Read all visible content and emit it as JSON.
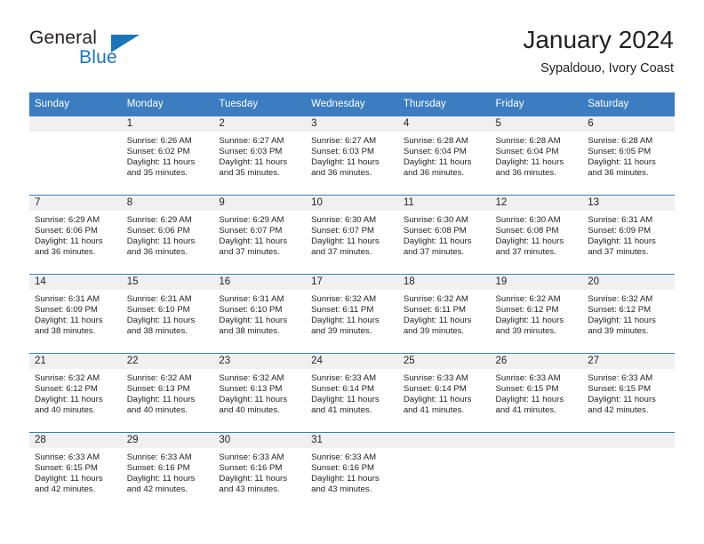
{
  "brand": {
    "name_part1": "General",
    "name_part2": "Blue",
    "logo_icon": "triangle-logo-icon"
  },
  "header": {
    "title": "January 2024",
    "subtitle": "Sypaldouo, Ivory Coast"
  },
  "colors": {
    "header_blue": "#3b7dc0",
    "brand_blue": "#1b75bb",
    "daynum_bg": "#f0f0f0",
    "text": "#231f20"
  },
  "calendar": {
    "weekdays": [
      "Sunday",
      "Monday",
      "Tuesday",
      "Wednesday",
      "Thursday",
      "Friday",
      "Saturday"
    ],
    "weeks": [
      [
        {
          "day": "",
          "blank": true,
          "sunrise": "",
          "sunset": "",
          "daylight1": "",
          "daylight2": ""
        },
        {
          "day": "1",
          "blank": false,
          "sunrise": "Sunrise: 6:26 AM",
          "sunset": "Sunset: 6:02 PM",
          "daylight1": "Daylight: 11 hours",
          "daylight2": "and 35 minutes."
        },
        {
          "day": "2",
          "blank": false,
          "sunrise": "Sunrise: 6:27 AM",
          "sunset": "Sunset: 6:03 PM",
          "daylight1": "Daylight: 11 hours",
          "daylight2": "and 35 minutes."
        },
        {
          "day": "3",
          "blank": false,
          "sunrise": "Sunrise: 6:27 AM",
          "sunset": "Sunset: 6:03 PM",
          "daylight1": "Daylight: 11 hours",
          "daylight2": "and 36 minutes."
        },
        {
          "day": "4",
          "blank": false,
          "sunrise": "Sunrise: 6:28 AM",
          "sunset": "Sunset: 6:04 PM",
          "daylight1": "Daylight: 11 hours",
          "daylight2": "and 36 minutes."
        },
        {
          "day": "5",
          "blank": false,
          "sunrise": "Sunrise: 6:28 AM",
          "sunset": "Sunset: 6:04 PM",
          "daylight1": "Daylight: 11 hours",
          "daylight2": "and 36 minutes."
        },
        {
          "day": "6",
          "blank": false,
          "sunrise": "Sunrise: 6:28 AM",
          "sunset": "Sunset: 6:05 PM",
          "daylight1": "Daylight: 11 hours",
          "daylight2": "and 36 minutes."
        }
      ],
      [
        {
          "day": "7",
          "blank": false,
          "sunrise": "Sunrise: 6:29 AM",
          "sunset": "Sunset: 6:06 PM",
          "daylight1": "Daylight: 11 hours",
          "daylight2": "and 36 minutes."
        },
        {
          "day": "8",
          "blank": false,
          "sunrise": "Sunrise: 6:29 AM",
          "sunset": "Sunset: 6:06 PM",
          "daylight1": "Daylight: 11 hours",
          "daylight2": "and 36 minutes."
        },
        {
          "day": "9",
          "blank": false,
          "sunrise": "Sunrise: 6:29 AM",
          "sunset": "Sunset: 6:07 PM",
          "daylight1": "Daylight: 11 hours",
          "daylight2": "and 37 minutes."
        },
        {
          "day": "10",
          "blank": false,
          "sunrise": "Sunrise: 6:30 AM",
          "sunset": "Sunset: 6:07 PM",
          "daylight1": "Daylight: 11 hours",
          "daylight2": "and 37 minutes."
        },
        {
          "day": "11",
          "blank": false,
          "sunrise": "Sunrise: 6:30 AM",
          "sunset": "Sunset: 6:08 PM",
          "daylight1": "Daylight: 11 hours",
          "daylight2": "and 37 minutes."
        },
        {
          "day": "12",
          "blank": false,
          "sunrise": "Sunrise: 6:30 AM",
          "sunset": "Sunset: 6:08 PM",
          "daylight1": "Daylight: 11 hours",
          "daylight2": "and 37 minutes."
        },
        {
          "day": "13",
          "blank": false,
          "sunrise": "Sunrise: 6:31 AM",
          "sunset": "Sunset: 6:09 PM",
          "daylight1": "Daylight: 11 hours",
          "daylight2": "and 37 minutes."
        }
      ],
      [
        {
          "day": "14",
          "blank": false,
          "sunrise": "Sunrise: 6:31 AM",
          "sunset": "Sunset: 6:09 PM",
          "daylight1": "Daylight: 11 hours",
          "daylight2": "and 38 minutes."
        },
        {
          "day": "15",
          "blank": false,
          "sunrise": "Sunrise: 6:31 AM",
          "sunset": "Sunset: 6:10 PM",
          "daylight1": "Daylight: 11 hours",
          "daylight2": "and 38 minutes."
        },
        {
          "day": "16",
          "blank": false,
          "sunrise": "Sunrise: 6:31 AM",
          "sunset": "Sunset: 6:10 PM",
          "daylight1": "Daylight: 11 hours",
          "daylight2": "and 38 minutes."
        },
        {
          "day": "17",
          "blank": false,
          "sunrise": "Sunrise: 6:32 AM",
          "sunset": "Sunset: 6:11 PM",
          "daylight1": "Daylight: 11 hours",
          "daylight2": "and 39 minutes."
        },
        {
          "day": "18",
          "blank": false,
          "sunrise": "Sunrise: 6:32 AM",
          "sunset": "Sunset: 6:11 PM",
          "daylight1": "Daylight: 11 hours",
          "daylight2": "and 39 minutes."
        },
        {
          "day": "19",
          "blank": false,
          "sunrise": "Sunrise: 6:32 AM",
          "sunset": "Sunset: 6:12 PM",
          "daylight1": "Daylight: 11 hours",
          "daylight2": "and 39 minutes."
        },
        {
          "day": "20",
          "blank": false,
          "sunrise": "Sunrise: 6:32 AM",
          "sunset": "Sunset: 6:12 PM",
          "daylight1": "Daylight: 11 hours",
          "daylight2": "and 39 minutes."
        }
      ],
      [
        {
          "day": "21",
          "blank": false,
          "sunrise": "Sunrise: 6:32 AM",
          "sunset": "Sunset: 6:12 PM",
          "daylight1": "Daylight: 11 hours",
          "daylight2": "and 40 minutes."
        },
        {
          "day": "22",
          "blank": false,
          "sunrise": "Sunrise: 6:32 AM",
          "sunset": "Sunset: 6:13 PM",
          "daylight1": "Daylight: 11 hours",
          "daylight2": "and 40 minutes."
        },
        {
          "day": "23",
          "blank": false,
          "sunrise": "Sunrise: 6:32 AM",
          "sunset": "Sunset: 6:13 PM",
          "daylight1": "Daylight: 11 hours",
          "daylight2": "and 40 minutes."
        },
        {
          "day": "24",
          "blank": false,
          "sunrise": "Sunrise: 6:33 AM",
          "sunset": "Sunset: 6:14 PM",
          "daylight1": "Daylight: 11 hours",
          "daylight2": "and 41 minutes."
        },
        {
          "day": "25",
          "blank": false,
          "sunrise": "Sunrise: 6:33 AM",
          "sunset": "Sunset: 6:14 PM",
          "daylight1": "Daylight: 11 hours",
          "daylight2": "and 41 minutes."
        },
        {
          "day": "26",
          "blank": false,
          "sunrise": "Sunrise: 6:33 AM",
          "sunset": "Sunset: 6:15 PM",
          "daylight1": "Daylight: 11 hours",
          "daylight2": "and 41 minutes."
        },
        {
          "day": "27",
          "blank": false,
          "sunrise": "Sunrise: 6:33 AM",
          "sunset": "Sunset: 6:15 PM",
          "daylight1": "Daylight: 11 hours",
          "daylight2": "and 42 minutes."
        }
      ],
      [
        {
          "day": "28",
          "blank": false,
          "sunrise": "Sunrise: 6:33 AM",
          "sunset": "Sunset: 6:15 PM",
          "daylight1": "Daylight: 11 hours",
          "daylight2": "and 42 minutes."
        },
        {
          "day": "29",
          "blank": false,
          "sunrise": "Sunrise: 6:33 AM",
          "sunset": "Sunset: 6:16 PM",
          "daylight1": "Daylight: 11 hours",
          "daylight2": "and 42 minutes."
        },
        {
          "day": "30",
          "blank": false,
          "sunrise": "Sunrise: 6:33 AM",
          "sunset": "Sunset: 6:16 PM",
          "daylight1": "Daylight: 11 hours",
          "daylight2": "and 43 minutes."
        },
        {
          "day": "31",
          "blank": false,
          "sunrise": "Sunrise: 6:33 AM",
          "sunset": "Sunset: 6:16 PM",
          "daylight1": "Daylight: 11 hours",
          "daylight2": "and 43 minutes."
        },
        {
          "day": "",
          "blank": true,
          "sunrise": "",
          "sunset": "",
          "daylight1": "",
          "daylight2": ""
        },
        {
          "day": "",
          "blank": true,
          "sunrise": "",
          "sunset": "",
          "daylight1": "",
          "daylight2": ""
        },
        {
          "day": "",
          "blank": true,
          "sunrise": "",
          "sunset": "",
          "daylight1": "",
          "daylight2": ""
        }
      ]
    ]
  }
}
